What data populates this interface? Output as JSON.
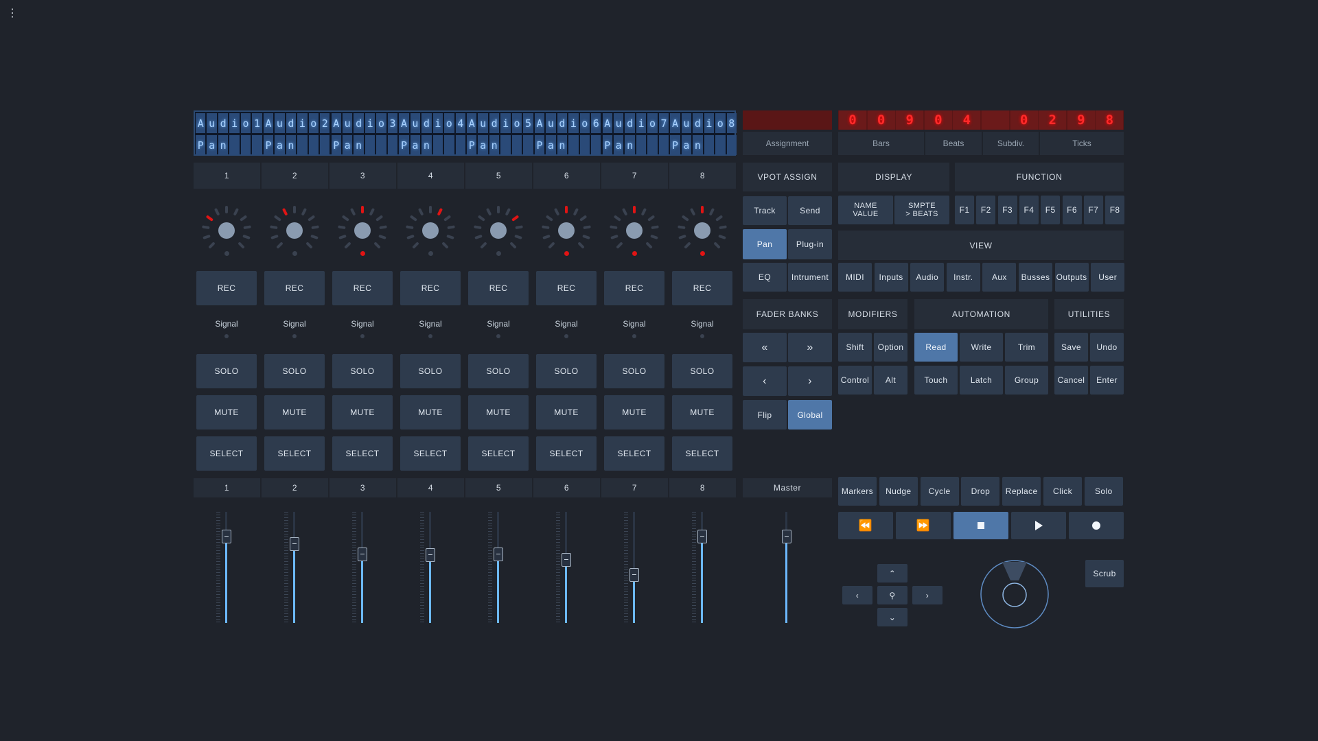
{
  "app": {
    "menu_icon": "kebab-menu-icon"
  },
  "lcd": {
    "row1": [
      "A",
      "u",
      "d",
      "i",
      "o",
      "1",
      "A",
      "u",
      "d",
      "i",
      "o",
      "2",
      "A",
      "u",
      "d",
      "i",
      "o",
      "3",
      "A",
      "u",
      "d",
      "i",
      "o",
      "4",
      "A",
      "u",
      "d",
      "i",
      "o",
      "5",
      "A",
      "u",
      "d",
      "i",
      "o",
      "6",
      "A",
      "u",
      "d",
      "i",
      "o",
      "7",
      "A",
      "u",
      "d",
      "i",
      "o",
      "8"
    ],
    "row2": [
      "P",
      "a",
      "n",
      "",
      "",
      "",
      "P",
      "a",
      "n",
      "",
      "",
      "",
      "P",
      "a",
      "n",
      "",
      "",
      "",
      "P",
      "a",
      "n",
      "",
      "",
      "",
      "P",
      "a",
      "n",
      "",
      "",
      "",
      "P",
      "a",
      "n",
      "",
      "",
      "",
      "P",
      "a",
      "n",
      "",
      "",
      "",
      "P",
      "a",
      "n",
      "",
      "",
      ""
    ]
  },
  "assignment": {
    "label": "Assignment"
  },
  "timecode": {
    "digits": [
      "0",
      "0",
      "9",
      "0",
      "4",
      "",
      "0",
      "2",
      "9",
      "8"
    ],
    "labels": [
      "Bars",
      "Beats",
      "Subdiv.",
      "Ticks"
    ]
  },
  "channels": [
    {
      "num": "1",
      "knob_led": 0,
      "vpot_dot": false,
      "rec": "REC",
      "signal": "Signal",
      "solo": "SOLO",
      "mute": "MUTE",
      "select": "SELECT",
      "fader_num": "1",
      "fader_level": 0.78
    },
    {
      "num": "2",
      "knob_led": 1,
      "vpot_dot": false,
      "rec": "REC",
      "signal": "Signal",
      "solo": "SOLO",
      "mute": "MUTE",
      "select": "SELECT",
      "fader_num": "2",
      "fader_level": 0.71
    },
    {
      "num": "3",
      "knob_led": 2,
      "vpot_dot": true,
      "rec": "REC",
      "signal": "Signal",
      "solo": "SOLO",
      "mute": "MUTE",
      "select": "SELECT",
      "fader_num": "3",
      "fader_level": 0.62
    },
    {
      "num": "4",
      "knob_led": 3,
      "vpot_dot": false,
      "rec": "REC",
      "signal": "Signal",
      "solo": "SOLO",
      "mute": "MUTE",
      "select": "SELECT",
      "fader_num": "4",
      "fader_level": 0.61
    },
    {
      "num": "5",
      "knob_led": 4,
      "vpot_dot": false,
      "rec": "REC",
      "signal": "Signal",
      "solo": "SOLO",
      "mute": "MUTE",
      "select": "SELECT",
      "fader_num": "5",
      "fader_level": 0.62
    },
    {
      "num": "6",
      "knob_led": 2,
      "vpot_dot": true,
      "rec": "REC",
      "signal": "Signal",
      "solo": "SOLO",
      "mute": "MUTE",
      "select": "SELECT",
      "fader_num": "6",
      "fader_level": 0.57
    },
    {
      "num": "7",
      "knob_led": 2,
      "vpot_dot": true,
      "rec": "REC",
      "signal": "Signal",
      "solo": "SOLO",
      "mute": "MUTE",
      "select": "SELECT",
      "fader_num": "7",
      "fader_level": 0.43
    },
    {
      "num": "8",
      "knob_led": 2,
      "vpot_dot": true,
      "rec": "REC",
      "signal": "Signal",
      "solo": "SOLO",
      "mute": "MUTE",
      "select": "SELECT",
      "fader_num": "8",
      "fader_level": 0.78
    }
  ],
  "master": {
    "label": "Master",
    "fader_level": 0.78
  },
  "vpot_assign": {
    "title": "VPOT ASSIGN",
    "track": "Track",
    "send": "Send",
    "pan": "Pan",
    "plugin": "Plug-in",
    "eq": "EQ",
    "instrument": "Intrument"
  },
  "fader_banks": {
    "title": "FADER BANKS",
    "bank_left": "«",
    "bank_right": "»",
    "chan_left": "‹",
    "chan_right": "›",
    "flip": "Flip",
    "global": "Global"
  },
  "display": {
    "title": "DISPLAY",
    "name_value": "NAME\nVALUE",
    "smpte_beats": "SMPTE\n> BEATS"
  },
  "function": {
    "title": "FUNCTION",
    "keys": [
      "F1",
      "F2",
      "F3",
      "F4",
      "F5",
      "F6",
      "F7",
      "F8"
    ]
  },
  "view": {
    "title": "VIEW",
    "items": [
      "MIDI",
      "Inputs",
      "Audio",
      "Instr.",
      "Aux",
      "Busses",
      "Outputs",
      "User"
    ]
  },
  "modifiers": {
    "title": "MODIFIERS",
    "shift": "Shift",
    "option": "Option",
    "control": "Control",
    "alt": "Alt"
  },
  "automation": {
    "title": "AUTOMATION",
    "read": "Read",
    "write": "Write",
    "trim": "Trim",
    "touch": "Touch",
    "latch": "Latch",
    "group": "Group"
  },
  "utilities": {
    "title": "UTILITIES",
    "save": "Save",
    "undo": "Undo",
    "cancel": "Cancel",
    "enter": "Enter"
  },
  "transport_row": {
    "items": [
      "Markers",
      "Nudge",
      "Cycle",
      "Drop",
      "Replace",
      "Click",
      "Solo"
    ]
  },
  "transport": {
    "rewind": "rewind-icon",
    "forward": "fast-forward-icon",
    "stop": "stop-icon",
    "play": "play-icon",
    "record": "record-icon"
  },
  "nav": {
    "up": "chevron-up-icon",
    "down": "chevron-down-icon",
    "left": "chevron-left-icon",
    "right": "chevron-right-icon",
    "zoom": "zoom-icon"
  },
  "scrub": {
    "label": "Scrub"
  },
  "colors": {
    "background": "#1f232b",
    "button": "#2e3b4d",
    "active": "#4f77a8",
    "lcd_text": "#a9d2ff",
    "led_red": "#e01414",
    "fader_fill": "#6cb8ff"
  }
}
